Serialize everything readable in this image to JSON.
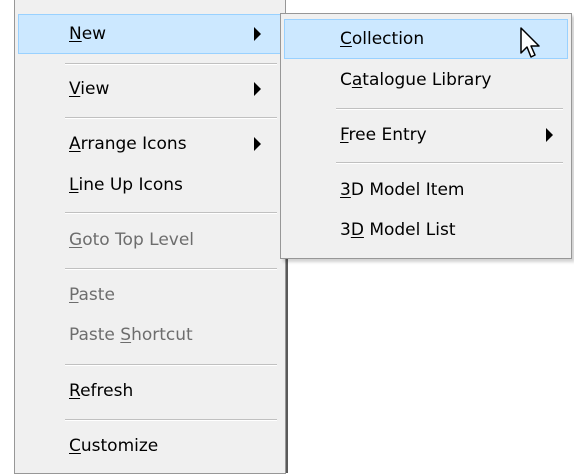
{
  "main_menu": {
    "items": [
      {
        "pre": "",
        "mn": "N",
        "post": "ew"
      },
      {
        "pre": "",
        "mn": "V",
        "post": "iew"
      },
      {
        "pre": "",
        "mn": "A",
        "post": "rrange Icons"
      },
      {
        "pre": "",
        "mn": "L",
        "post": "ine Up Icons"
      },
      {
        "pre": "",
        "mn": "G",
        "post": "oto Top Level"
      },
      {
        "pre": "",
        "mn": "P",
        "post": "aste"
      },
      {
        "pre": "Paste ",
        "mn": "S",
        "post": "hortcut"
      },
      {
        "pre": "",
        "mn": "R",
        "post": "efresh"
      },
      {
        "pre": "",
        "mn": "C",
        "post": "ustomize"
      }
    ]
  },
  "sub_menu": {
    "items": [
      {
        "pre": "",
        "mn": "C",
        "post": "ollection"
      },
      {
        "pre": "C",
        "mn": "a",
        "post": "talogue Library"
      },
      {
        "pre": "",
        "mn": "F",
        "post": "ree Entry"
      },
      {
        "pre": "",
        "mn": "3",
        "post": "D Model Item"
      },
      {
        "pre": "3",
        "mn": "D",
        "post": " Model List"
      }
    ]
  },
  "colors": {
    "menu_bg": "#f0f0f0",
    "highlight_bg": "#cce8ff",
    "highlight_border": "#99d1ff",
    "disabled_text": "#6d6d6d"
  },
  "icons": {
    "submenu": "arrow-right-icon",
    "pointer": "mouse-pointer-icon"
  }
}
